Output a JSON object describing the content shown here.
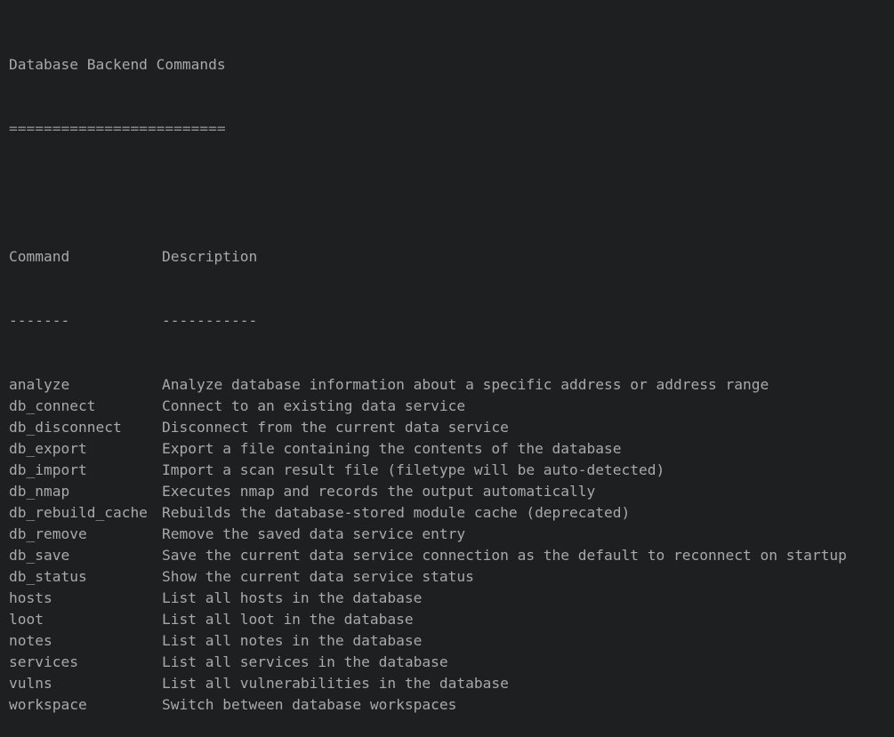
{
  "terminal": {
    "title": "Database Backend Commands",
    "title_underline": "=========================",
    "header": {
      "command": "Command",
      "description": "Description"
    },
    "header_underline": {
      "command": "-------",
      "description": "-----------"
    },
    "rows": [
      {
        "command": "analyze",
        "description": "Analyze database information about a specific address or address range"
      },
      {
        "command": "db_connect",
        "description": "Connect to an existing data service"
      },
      {
        "command": "db_disconnect",
        "description": "Disconnect from the current data service"
      },
      {
        "command": "db_export",
        "description": "Export a file containing the contents of the database"
      },
      {
        "command": "db_import",
        "description": "Import a scan result file (filetype will be auto-detected)"
      },
      {
        "command": "db_nmap",
        "description": "Executes nmap and records the output automatically"
      },
      {
        "command": "db_rebuild_cache",
        "description": "Rebuilds the database-stored module cache (deprecated)"
      },
      {
        "command": "db_remove",
        "description": "Remove the saved data service entry"
      },
      {
        "command": "db_save",
        "description": "Save the current data service connection as the default to reconnect on startup"
      },
      {
        "command": "db_status",
        "description": "Show the current data service status"
      },
      {
        "command": "hosts",
        "description": "List all hosts in the database"
      },
      {
        "command": "loot",
        "description": "List all loot in the database"
      },
      {
        "command": "notes",
        "description": "List all notes in the database"
      },
      {
        "command": "services",
        "description": "List all services in the database"
      },
      {
        "command": "vulns",
        "description": "List all vulnerabilities in the database"
      },
      {
        "command": "workspace",
        "description": "Switch between database workspaces"
      }
    ],
    "colors": {
      "background": "#1e1f21",
      "text": "#a9a9a9"
    }
  }
}
